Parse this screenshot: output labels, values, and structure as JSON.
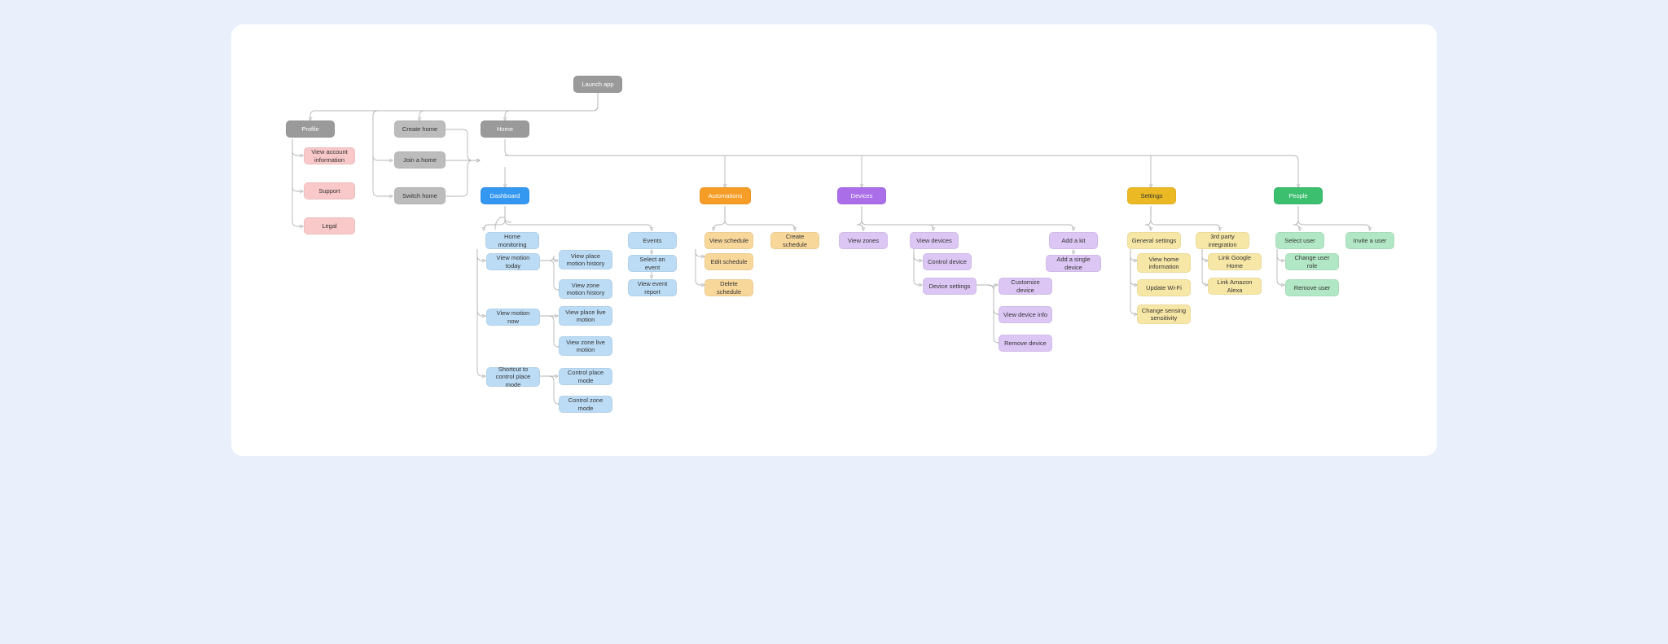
{
  "nodes": {
    "launch_app": "Launch app",
    "profile": "Profile",
    "create_home": "Create home",
    "join_home": "Join a home",
    "switch_home": "Switch home",
    "home": "Home",
    "view_account_info": "View account information",
    "support": "Support",
    "legal": "Legal",
    "dashboard": "Dashboard",
    "automations": "Automations",
    "devices": "Devices",
    "settings": "Settings",
    "people": "People",
    "home_monitoring": "Home monitoring",
    "events": "Events",
    "view_motion_today": "View motion today",
    "view_motion_now": "View motion now",
    "shortcut_control_place_mode": "Shortcut to control place mode",
    "view_place_motion_history": "View place motion history",
    "view_zone_motion_history": "View zone motion history",
    "view_place_live_motion": "View place live motion",
    "view_zone_live_motion": "View zone live motion",
    "control_place_mode": "Control place mode",
    "control_zone_mode": "Control zone mode",
    "select_event": "Select an event",
    "view_event_report": "View event report",
    "view_schedule": "View schedule",
    "edit_schedule": "Edit schedule",
    "delete_schedule": "Delete schedule",
    "create_schedule": "Create schedule",
    "view_zones": "View zones",
    "view_devices": "View devices",
    "control_device": "Control device",
    "device_settings": "Device settings",
    "customize_device": "Customize device",
    "view_device_info": "View device info",
    "remove_device": "Remove device",
    "add_kit": "Add a kit",
    "add_single_device": "Add a single device",
    "general_settings": "General settings",
    "view_home_info": "View home information",
    "update_wifi": "Update Wi-Fi",
    "change_sensing": "Change sensing sensitivity",
    "third_party": "3rd party integration",
    "link_google": "Link Google Home",
    "link_alexa": "Link Amazon Alexa",
    "select_user": "Select user",
    "change_user_role": "Change user role",
    "remove_user": "Remove user",
    "invite_user": "Invite a user"
  }
}
